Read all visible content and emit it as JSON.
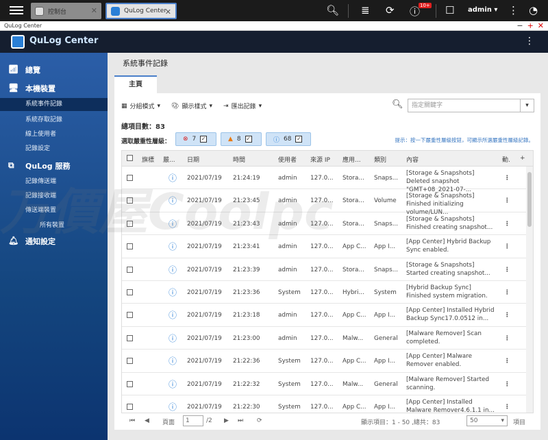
{
  "topbar": {
    "tab1": "控制台",
    "tab2": "QuLog Center",
    "badge": "10+",
    "user": "admin"
  },
  "app": {
    "window_title": "QuLog Center",
    "name": "QuLog Center"
  },
  "sidebar": {
    "overview": "總覽",
    "local": "本機裝置",
    "local_items": [
      "系統事件記錄",
      "系統存取記錄",
      "線上使用者",
      "記錄設定"
    ],
    "qulog_service": "QuLog 服務",
    "service_items": [
      "記錄傳送端",
      "記錄接收端",
      "傳送端裝置"
    ],
    "all_devices": "所有裝置",
    "notification": "通知設定"
  },
  "main": {
    "title": "系統事件記錄",
    "tab": "主頁",
    "toolbar": {
      "group": "分組模式",
      "display": "顯示樣式",
      "export": "匯出記錄"
    },
    "search_placeholder": "指定關鍵字",
    "total_label": "總項目數：",
    "total": "83",
    "severity_label": "選取嚴重性層級：",
    "severity": {
      "error": "7",
      "warning": "8",
      "info": "68"
    },
    "hint": "提示：按一下嚴重性層級按鈕，可顯示所選嚴重性層級記錄。",
    "columns": {
      "flag": "旗標",
      "sev": "嚴...",
      "date": "日期",
      "time": "時間",
      "user": "使用者",
      "ip": "來源 IP",
      "app": "應用...",
      "cat": "類別",
      "content": "內容",
      "act": "動.",
      "plus": "+"
    },
    "rows": [
      {
        "date": "2021/07/19",
        "time": "21:24:19",
        "user": "admin",
        "ip": "127.0...",
        "app": "Stora...",
        "cat": "Snaps...",
        "content": "[Storage & Snapshots] Deleted snapshot \"GMT+08_2021-07-..."
      },
      {
        "date": "2021/07/19",
        "time": "21:23:45",
        "user": "admin",
        "ip": "127.0...",
        "app": "Stora...",
        "cat": "Volume",
        "content": "[Storage & Snapshots] Finished initializing volume/LUN..."
      },
      {
        "date": "2021/07/19",
        "time": "21:23:43",
        "user": "admin",
        "ip": "127.0...",
        "app": "Stora...",
        "cat": "Snaps...",
        "content": "[Storage & Snapshots] Finished creating snapshot..."
      },
      {
        "date": "2021/07/19",
        "time": "21:23:41",
        "user": "admin",
        "ip": "127.0...",
        "app": "App C...",
        "cat": "App I...",
        "content": "[App Center] Hybrid Backup Sync enabled."
      },
      {
        "date": "2021/07/19",
        "time": "21:23:39",
        "user": "admin",
        "ip": "127.0...",
        "app": "Stora...",
        "cat": "Snaps...",
        "content": "[Storage & Snapshots] Started creating snapshot..."
      },
      {
        "date": "2021/07/19",
        "time": "21:23:36",
        "user": "System",
        "ip": "127.0...",
        "app": "Hybri...",
        "cat": "System",
        "content": "[Hybrid Backup Sync] Finished system migration."
      },
      {
        "date": "2021/07/19",
        "time": "21:23:18",
        "user": "admin",
        "ip": "127.0...",
        "app": "App C...",
        "cat": "App I...",
        "content": "[App Center] Installed Hybrid Backup Sync17.0.0512 in..."
      },
      {
        "date": "2021/07/19",
        "time": "21:23:00",
        "user": "admin",
        "ip": "127.0...",
        "app": "Malw...",
        "cat": "General",
        "content": "[Malware Remover] Scan completed."
      },
      {
        "date": "2021/07/19",
        "time": "21:22:36",
        "user": "System",
        "ip": "127.0...",
        "app": "App C...",
        "cat": "App I...",
        "content": "[App Center] Malware Remover enabled."
      },
      {
        "date": "2021/07/19",
        "time": "21:22:32",
        "user": "System",
        "ip": "127.0...",
        "app": "Malw...",
        "cat": "General",
        "content": "[Malware Remover] Started scanning."
      },
      {
        "date": "2021/07/19",
        "time": "21:22:30",
        "user": "System",
        "ip": "127.0...",
        "app": "App C...",
        "cat": "App I...",
        "content": "[App Center] Installed Malware Remover4.6.1.1 in..."
      }
    ],
    "footer": {
      "page_label": "頁面",
      "page": "1",
      "of": "/2",
      "summary": "顯示項目：1 - 50 ,總共：83",
      "per_page": "50",
      "items_label": "項目"
    }
  },
  "watermark": "万價屋Coolpc"
}
